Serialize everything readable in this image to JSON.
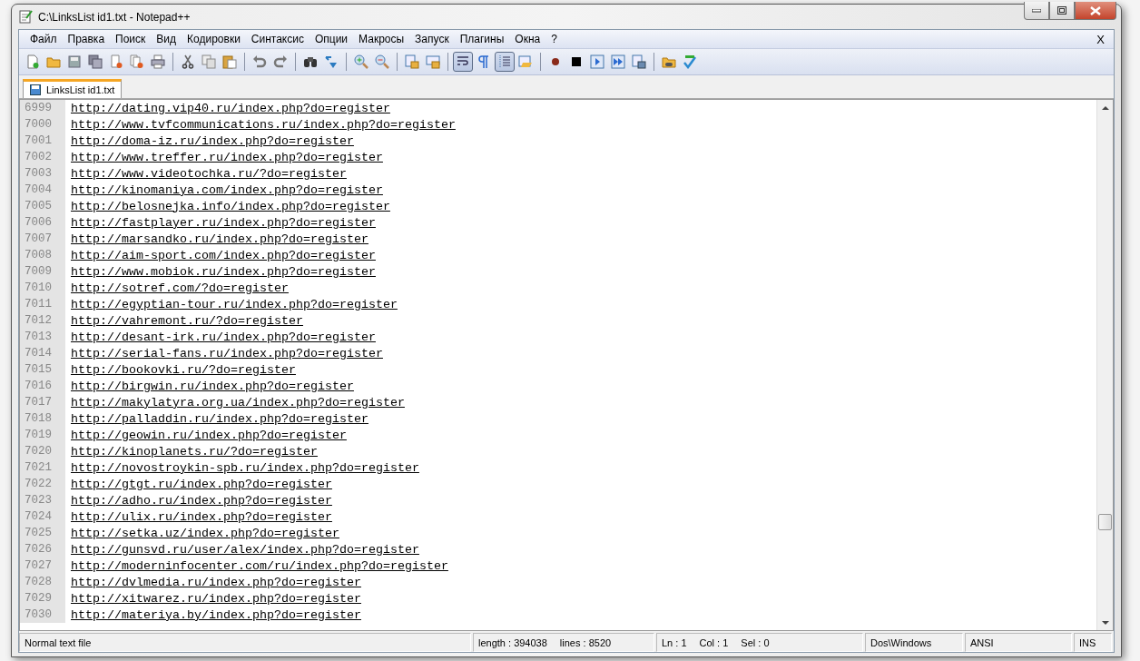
{
  "window": {
    "title": "C:\\LinksList id1.txt - Notepad++"
  },
  "menu": {
    "items": [
      "Файл",
      "Правка",
      "Поиск",
      "Вид",
      "Кодировки",
      "Синтаксис",
      "Опции",
      "Макросы",
      "Запуск",
      "Плагины",
      "Окна",
      "?"
    ],
    "close_label": "X"
  },
  "toolbar": [
    {
      "kind": "new",
      "pressed": false
    },
    {
      "kind": "open",
      "pressed": false
    },
    {
      "kind": "save",
      "pressed": false
    },
    {
      "kind": "save-all",
      "pressed": false
    },
    {
      "kind": "close",
      "pressed": false
    },
    {
      "kind": "close-all",
      "pressed": false
    },
    {
      "kind": "print",
      "pressed": false
    },
    {
      "kind": "separator"
    },
    {
      "kind": "cut",
      "pressed": false
    },
    {
      "kind": "copy",
      "pressed": false
    },
    {
      "kind": "paste",
      "pressed": false
    },
    {
      "kind": "separator"
    },
    {
      "kind": "undo",
      "pressed": false
    },
    {
      "kind": "redo",
      "pressed": false
    },
    {
      "kind": "separator"
    },
    {
      "kind": "find",
      "pressed": false
    },
    {
      "kind": "replace",
      "pressed": false
    },
    {
      "kind": "separator"
    },
    {
      "kind": "zoom-in",
      "pressed": false
    },
    {
      "kind": "zoom-out",
      "pressed": false
    },
    {
      "kind": "separator"
    },
    {
      "kind": "sync-v",
      "pressed": false
    },
    {
      "kind": "sync-h",
      "pressed": false
    },
    {
      "kind": "separator"
    },
    {
      "kind": "wrap",
      "pressed": true
    },
    {
      "kind": "pilcrow",
      "pressed": false
    },
    {
      "kind": "indent",
      "pressed": true
    },
    {
      "kind": "folder-map",
      "pressed": false
    },
    {
      "kind": "separator"
    },
    {
      "kind": "record",
      "pressed": false
    },
    {
      "kind": "stop",
      "pressed": false
    },
    {
      "kind": "play",
      "pressed": false
    },
    {
      "kind": "play-multi",
      "pressed": false
    },
    {
      "kind": "save-macro",
      "pressed": false
    },
    {
      "kind": "separator"
    },
    {
      "kind": "folder",
      "pressed": false
    },
    {
      "kind": "spellcheck",
      "pressed": false
    }
  ],
  "tabs": [
    {
      "label": "LinksList id1.txt",
      "selected": true
    }
  ],
  "lines": [
    {
      "number": "6999",
      "text": "http://dating.vip40.ru/index.php?do=register"
    },
    {
      "number": "7000",
      "text": "http://www.tvfcommunications.ru/index.php?do=register"
    },
    {
      "number": "7001",
      "text": "http://doma-iz.ru/index.php?do=register"
    },
    {
      "number": "7002",
      "text": "http://www.treffer.ru/index.php?do=register"
    },
    {
      "number": "7003",
      "text": "http://www.videotochka.ru/?do=register"
    },
    {
      "number": "7004",
      "text": "http://kinomaniya.com/index.php?do=register"
    },
    {
      "number": "7005",
      "text": "http://belosnejka.info/index.php?do=register"
    },
    {
      "number": "7006",
      "text": "http://fastplayer.ru/index.php?do=register"
    },
    {
      "number": "7007",
      "text": "http://marsandko.ru/index.php?do=register"
    },
    {
      "number": "7008",
      "text": "http://aim-sport.com/index.php?do=register"
    },
    {
      "number": "7009",
      "text": "http://www.mobiok.ru/index.php?do=register"
    },
    {
      "number": "7010",
      "text": "http://sotref.com/?do=register"
    },
    {
      "number": "7011",
      "text": "http://egyptian-tour.ru/index.php?do=register"
    },
    {
      "number": "7012",
      "text": "http://vahremont.ru/?do=register"
    },
    {
      "number": "7013",
      "text": "http://desant-irk.ru/index.php?do=register"
    },
    {
      "number": "7014",
      "text": "http://serial-fans.ru/index.php?do=register"
    },
    {
      "number": "7015",
      "text": "http://bookovki.ru/?do=register"
    },
    {
      "number": "7016",
      "text": "http://birgwin.ru/index.php?do=register"
    },
    {
      "number": "7017",
      "text": "http://makylatyra.org.ua/index.php?do=register"
    },
    {
      "number": "7018",
      "text": "http://palladdin.ru/index.php?do=register"
    },
    {
      "number": "7019",
      "text": "http://geowin.ru/index.php?do=register"
    },
    {
      "number": "7020",
      "text": "http://kinoplanets.ru/?do=register"
    },
    {
      "number": "7021",
      "text": "http://novostroykin-spb.ru/index.php?do=register"
    },
    {
      "number": "7022",
      "text": "http://gtgt.ru/index.php?do=register"
    },
    {
      "number": "7023",
      "text": "http://adho.ru/index.php?do=register"
    },
    {
      "number": "7024",
      "text": "http://ulix.ru/index.php?do=register"
    },
    {
      "number": "7025",
      "text": "http://setka.uz/index.php?do=register"
    },
    {
      "number": "7026",
      "text": "http://gunsvd.ru/user/alex/index.php?do=register"
    },
    {
      "number": "7027",
      "text": "http://moderninfocenter.com/ru/index.php?do=register"
    },
    {
      "number": "7028",
      "text": "http://dvlmedia.ru/index.php?do=register"
    },
    {
      "number": "7029",
      "text": "http://xitwarez.ru/index.php?do=register"
    },
    {
      "number": "7030",
      "text": "http://materiya.by/index.php?do=register"
    }
  ],
  "status_bar": {
    "file_type": "Normal text file",
    "length": "length : 394038",
    "lines": "lines : 8520",
    "ln": "Ln : 1",
    "col": "Col : 1",
    "sel": "Sel : 0",
    "eol": "Dos\\Windows",
    "encoding": "ANSI",
    "mode": "INS"
  }
}
